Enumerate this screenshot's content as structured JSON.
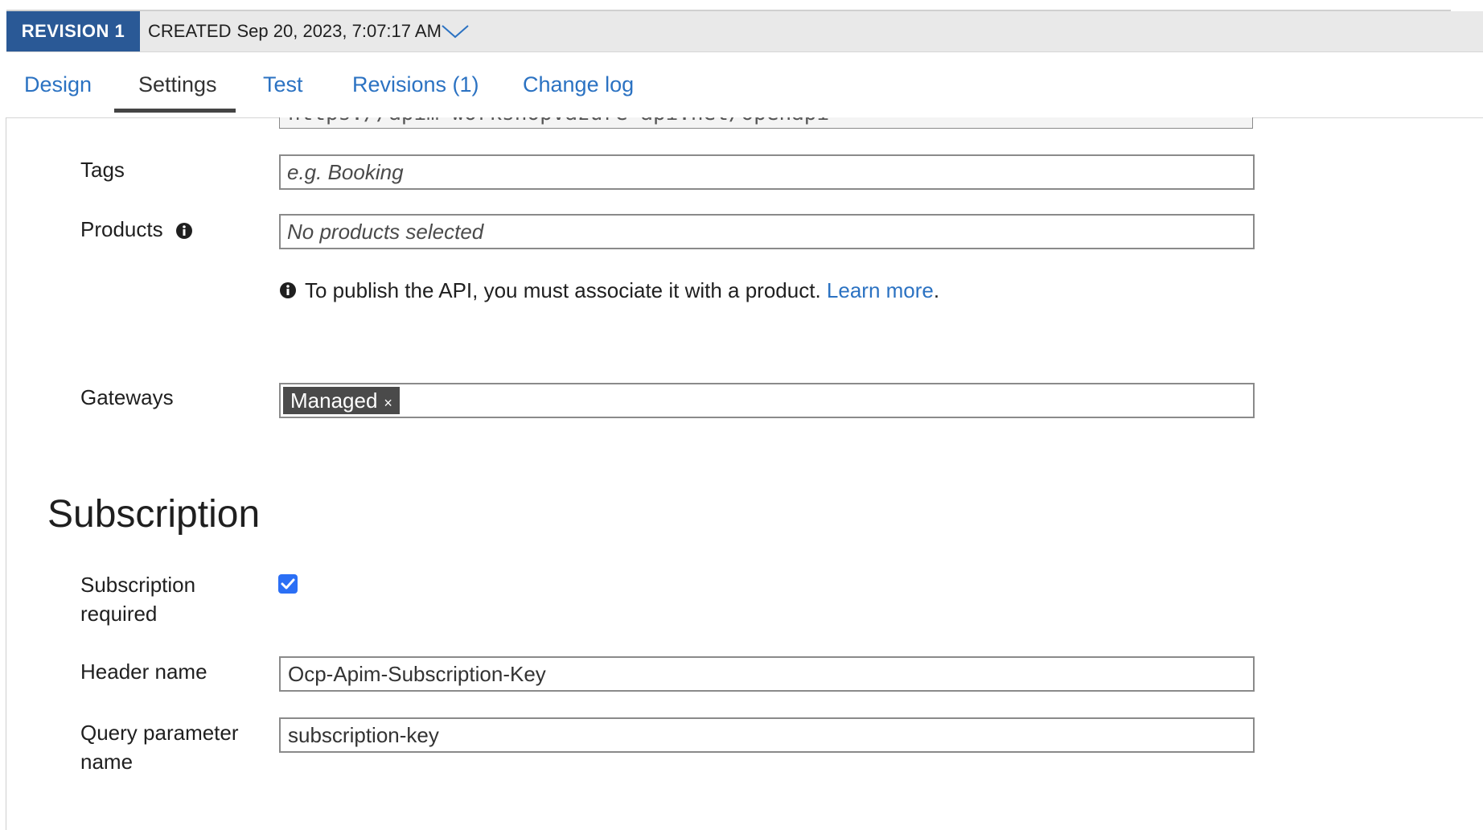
{
  "revision": {
    "badge": "REVISION 1",
    "created_label": "CREATED",
    "created_value": "Sep 20, 2023, 7:07:17 AM"
  },
  "tabs": [
    {
      "label": "Design"
    },
    {
      "label": "Settings",
      "active": true
    },
    {
      "label": "Test"
    },
    {
      "label": "Revisions (1)"
    },
    {
      "label": "Change log"
    }
  ],
  "url_field": {
    "value": "https://apim-workshopvazure-api.net/openapi"
  },
  "tags": {
    "label": "Tags",
    "placeholder": "e.g. Booking"
  },
  "products": {
    "label": "Products",
    "placeholder": "No products selected"
  },
  "notice": {
    "text": "To publish the API, you must associate it with a product.",
    "link": "Learn more",
    "period": "."
  },
  "gateways": {
    "label": "Gateways",
    "chip": "Managed",
    "chip_remove": "×"
  },
  "subscription": {
    "title": "Subscription",
    "required_label_line1": "Subscription",
    "required_label_line2": "required",
    "required_checked": true,
    "header_label": "Header name",
    "header_value": "Ocp-Apim-Subscription-Key",
    "query_label_line1": "Query parameter",
    "query_label_line2": "name",
    "query_value": "subscription-key"
  },
  "colors": {
    "accent": "#2b72c2",
    "badge": "#2a5996",
    "checkbox": "#2b6ff5"
  }
}
